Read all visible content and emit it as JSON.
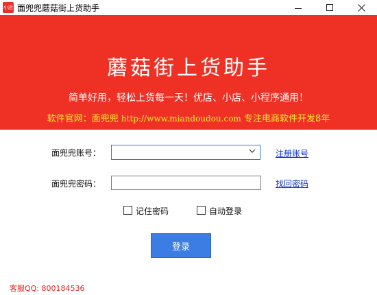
{
  "window": {
    "icon_text": "小店",
    "title": "面兜兜蘑菇街上货助手",
    "icons": {
      "minimize": "minimize-icon",
      "maximize": "maximize-icon",
      "close": "close-icon"
    }
  },
  "banner": {
    "title": "蘑菇街上货助手",
    "slogan": "简单好用，轻松上货每一天！优店、小店、小程序通用！",
    "site_prefix": "软件官网：面兜兜 ",
    "site_url": "http://www.miandoudou.com",
    "site_suffix": " 专注电商软件开发8年"
  },
  "form": {
    "account_label": "面兜兜账号：",
    "account_value": "",
    "password_label": "面兜兜密码：",
    "password_value": "",
    "register_link": "注册账号",
    "recover_link": "找回密码",
    "remember_label": "记住密码",
    "remember_checked": false,
    "autologin_label": "自动登录",
    "autologin_checked": false,
    "login_button": "登录"
  },
  "footer": {
    "service": "客服QQ: 800184536"
  },
  "colors": {
    "banner": "#ee3124",
    "site_text": "#ffee33",
    "button": "#3b7de3",
    "link": "#0a2fd3",
    "service": "#e0201a"
  }
}
